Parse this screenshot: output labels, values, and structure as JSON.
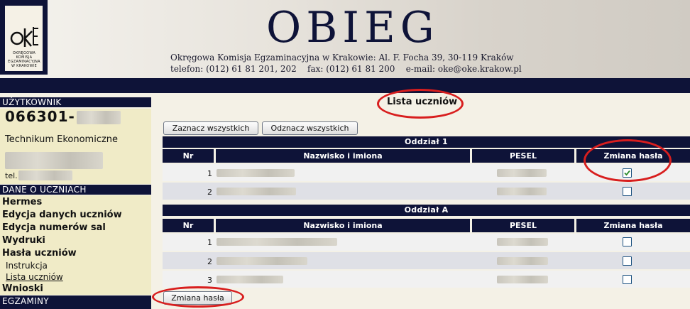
{
  "header": {
    "brand": "OBIEG",
    "address": "Okręgowa Komisja Egzaminacyjna w Krakowie: Al. F. Focha 39, 30-119 Kraków",
    "contact": "telefon: (012) 61 81 201, 202    fax: (012) 61 81 200    e-mail: oke@oke.krakow.pl",
    "logo_text": "OKRĘGOWA KOMISJA EGZAMINACYJNA W KRAKOWIE"
  },
  "sidebar": {
    "user_header": "UŻYTKOWNIK",
    "user_id": "066301-",
    "school": "Technikum Ekonomiczne",
    "tel_label": "tel.",
    "students_header": "DANE O UCZNIACH",
    "items": [
      {
        "label": "Hermes"
      },
      {
        "label": "Edycja danych uczniów"
      },
      {
        "label": "Edycja numerów sal"
      },
      {
        "label": "Wydruki"
      },
      {
        "label": "Hasła uczniów"
      }
    ],
    "subitems": [
      {
        "label": "Instrukcja"
      },
      {
        "label": "Lista uczniów"
      }
    ],
    "last_item": "Wnioski",
    "exams_header": "EGZAMINY"
  },
  "main": {
    "title": "Lista uczniów",
    "select_all": "Zaznacz wszystkich",
    "deselect_all": "Odznacz wszystkich",
    "submit": "Zmiana hasła",
    "columns": [
      "Nr",
      "Nazwisko i imiona",
      "PESEL",
      "Zmiana hasła"
    ],
    "groups": [
      {
        "name": "Oddział 1",
        "rows": [
          {
            "nr": "1",
            "checked": true
          },
          {
            "nr": "2",
            "checked": false
          }
        ]
      },
      {
        "name": "Oddział A",
        "rows": [
          {
            "nr": "1",
            "checked": false
          },
          {
            "nr": "2",
            "checked": false
          },
          {
            "nr": "3",
            "checked": false
          }
        ]
      }
    ]
  },
  "colors": {
    "navy": "#0e1338",
    "sidebar_bg": "#f0ebc7",
    "annotation_red": "#d81e1e"
  }
}
